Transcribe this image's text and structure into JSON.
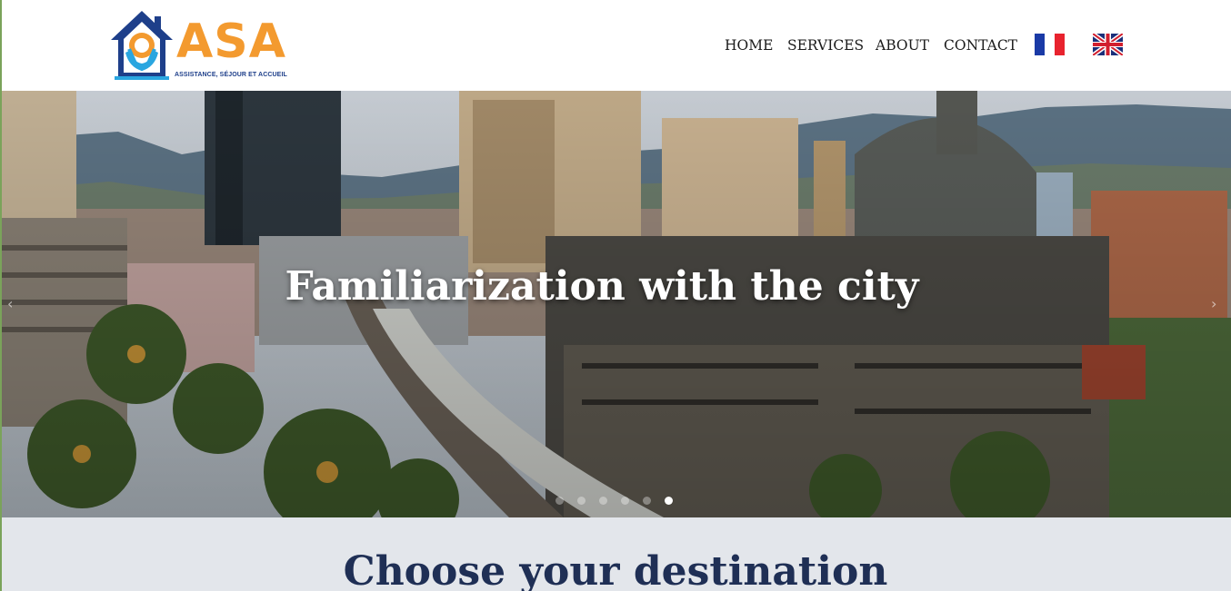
{
  "logo": {
    "name": "ASA",
    "tagline": "ASSISTANCE, SÉJOUR ET ACCUEIL",
    "colors": {
      "house": "#1e3f8a",
      "sun": "#f39a2f",
      "hands": "#2aa6e0"
    }
  },
  "nav": {
    "items": [
      {
        "label": "HOME"
      },
      {
        "label": "SERVICES"
      },
      {
        "label": "ABOUT"
      },
      {
        "label": "CONTACT"
      }
    ],
    "languages": [
      {
        "icon": "flag-france-icon"
      },
      {
        "icon": "flag-uk-icon"
      }
    ]
  },
  "hero": {
    "title": "Familiarization with the city",
    "slides_count": 6,
    "active_slide": 6,
    "prev_icon": "chevron-left-icon",
    "next_icon": "chevron-right-icon"
  },
  "section": {
    "title": "Choose your destination"
  }
}
